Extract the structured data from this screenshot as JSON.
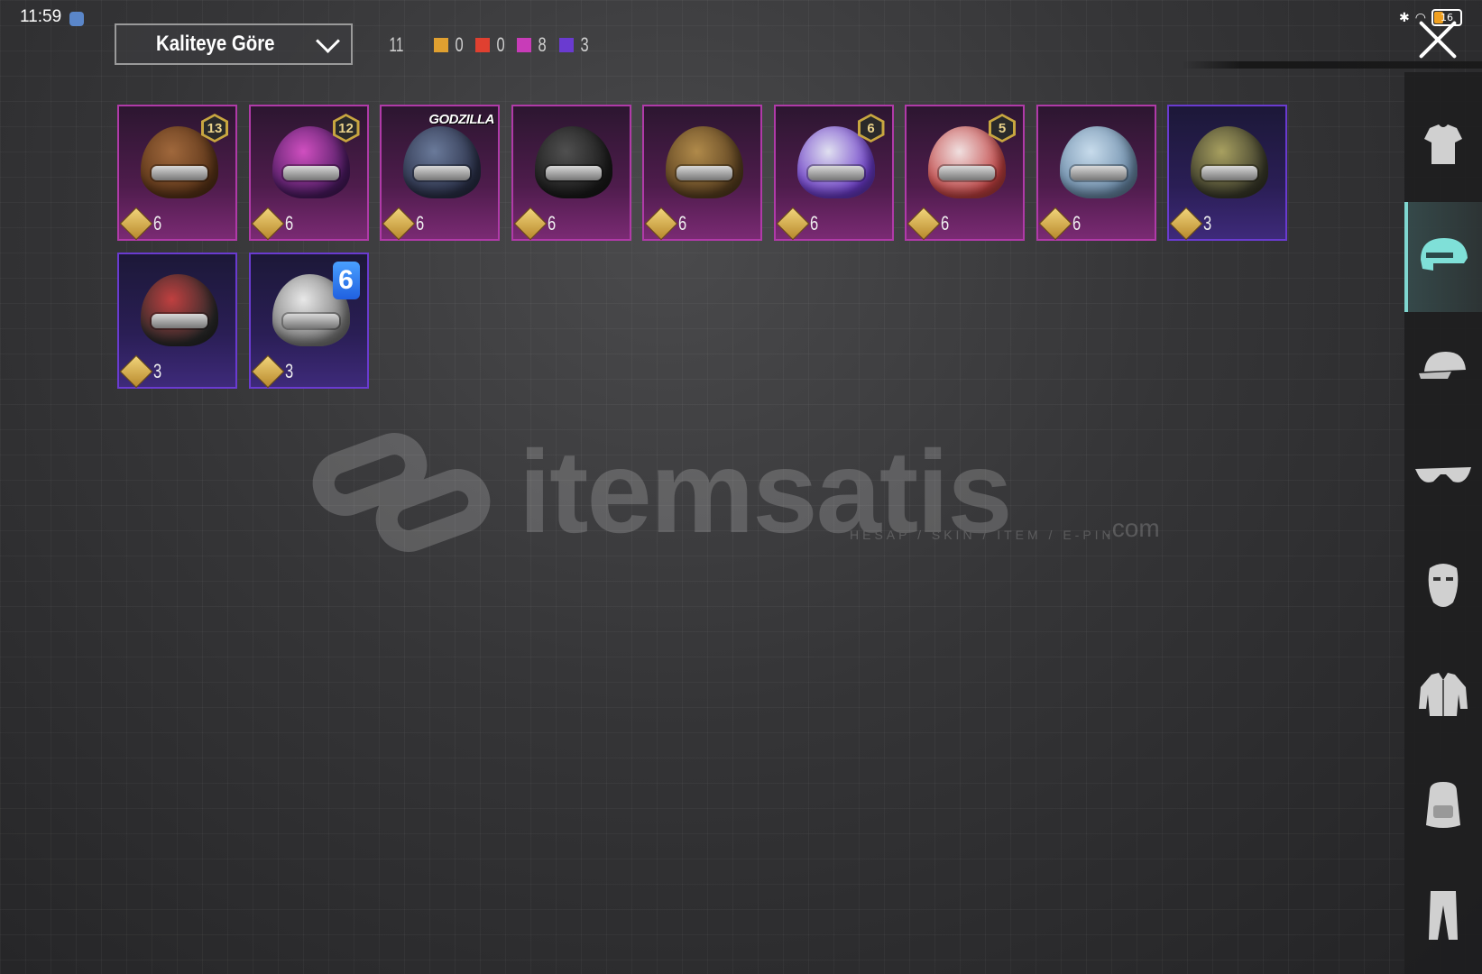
{
  "status_bar": {
    "time": "11:59",
    "battery": "16"
  },
  "sort": {
    "label": "Kaliteye Göre"
  },
  "counts": {
    "total": "11",
    "rarities": [
      {
        "color": "#e0a030",
        "value": "0"
      },
      {
        "color": "#e04030",
        "value": "0"
      },
      {
        "color": "#c83cb8",
        "value": "8"
      },
      {
        "color": "#6a3bd0",
        "value": "3"
      }
    ]
  },
  "items": [
    {
      "count": "6",
      "level": "13",
      "rarity": "purple",
      "colors": [
        "#a0683c",
        "#5a3418"
      ],
      "icon": "steampunk-helmet-icon"
    },
    {
      "count": "6",
      "level": "12",
      "rarity": "purple",
      "colors": [
        "#d04fc0",
        "#4a1a60"
      ],
      "icon": "bunny-helmet-icon"
    },
    {
      "count": "6",
      "brand": "GODZILLA",
      "rarity": "purple",
      "colors": [
        "#6a7a9a",
        "#2a3048"
      ],
      "icon": "godzilla-helmet-icon"
    },
    {
      "count": "6",
      "rarity": "purple",
      "colors": [
        "#505050",
        "#1a1a1a"
      ],
      "icon": "bird-helmet-icon"
    },
    {
      "count": "6",
      "rarity": "purple",
      "colors": [
        "#b08a4a",
        "#5a4020"
      ],
      "icon": "knit-helmet-icon"
    },
    {
      "count": "6",
      "level": "6",
      "rarity": "purple",
      "colors": [
        "#e0e0f0",
        "#6a3ac8"
      ],
      "icon": "purple-white-helmet-icon"
    },
    {
      "count": "6",
      "level": "5",
      "rarity": "purple",
      "colors": [
        "#f0e0e0",
        "#c04040"
      ],
      "icon": "samurai-helmet-icon"
    },
    {
      "count": "6",
      "rarity": "purple",
      "colors": [
        "#c8dcec",
        "#6a8aa8"
      ],
      "icon": "ice-helmet-icon"
    },
    {
      "count": "3",
      "rarity": "blue",
      "colors": [
        "#a8a060",
        "#3a3a2a"
      ],
      "icon": "spiked-helmet-icon"
    },
    {
      "count": "3",
      "rarity": "blue",
      "colors": [
        "#c04040",
        "#2a2a2a"
      ],
      "icon": "red-black-helmet-icon"
    },
    {
      "count": "3",
      "level_blue": "6",
      "rarity": "blue",
      "colors": [
        "#e8e8e8",
        "#7a7a7a"
      ],
      "icon": "white-helmet-icon"
    }
  ],
  "sidebar": [
    {
      "icon": "outfit-icon",
      "active": false
    },
    {
      "icon": "helmet-icon",
      "active": true
    },
    {
      "icon": "cap-icon",
      "active": false
    },
    {
      "icon": "glasses-icon",
      "active": false
    },
    {
      "icon": "mask-icon",
      "active": false
    },
    {
      "icon": "jacket-icon",
      "active": false
    },
    {
      "icon": "backpack-icon",
      "active": false
    },
    {
      "icon": "pants-icon",
      "active": false
    }
  ],
  "watermark": {
    "brand": "itemsatis",
    "sub": "HESAP / SKIN / ITEM / E-PIN",
    "com": ".com"
  }
}
